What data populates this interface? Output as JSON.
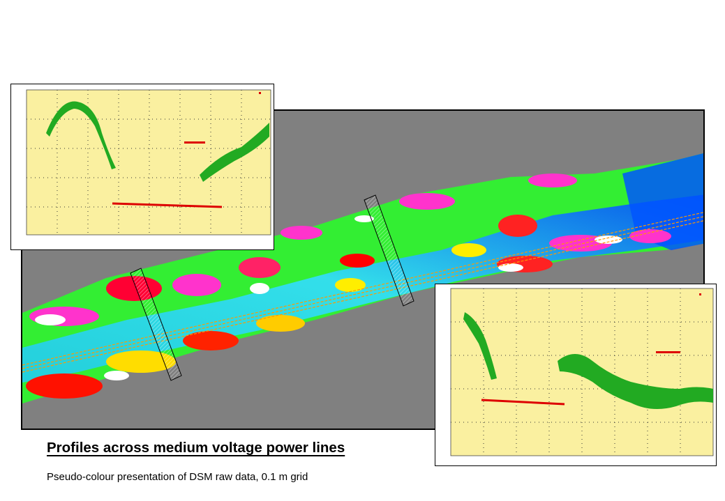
{
  "caption": {
    "title": "Profiles across medium voltage power lines",
    "subtitle": "Pseudo-colour presentation of DSM raw data, 0.1 m grid"
  },
  "map": {
    "background_color": "#808080",
    "palette": [
      "#ff0000",
      "#ff33cc",
      "#ffffff",
      "#00ff00",
      "#ffff00",
      "#00ffff",
      "#33aaff",
      "#0044ff"
    ],
    "profile_bands": 2
  },
  "profile_left": {
    "plot_background": "#faf0a0",
    "legend_label": "",
    "point_colors": {
      "vegetation": "#22aa22",
      "line": "#dd0000"
    }
  },
  "profile_right": {
    "plot_background": "#faf0a0",
    "legend_label": "",
    "point_colors": {
      "vegetation": "#22aa22",
      "line": "#dd0000"
    }
  }
}
